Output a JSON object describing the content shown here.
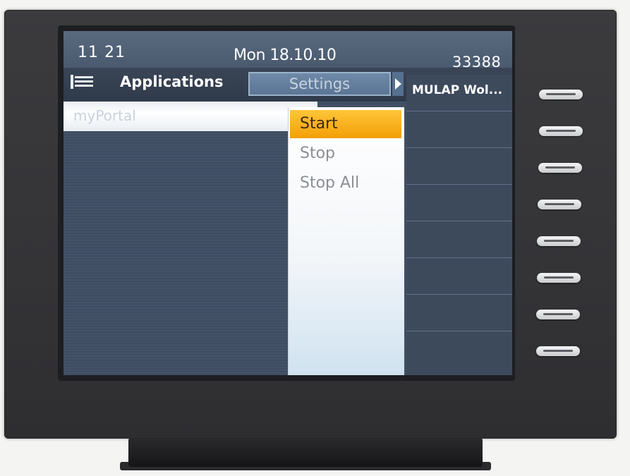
{
  "status_bar": {
    "time": "11 21",
    "date": "Mon 18.10.10",
    "extension": "33388"
  },
  "tabs": {
    "menu_icon": "menu-list-icon",
    "applications_label": "Applications",
    "settings_label": "Settings",
    "next_icon": "triangle-right-icon"
  },
  "list": {
    "items": [
      {
        "label": "myPortal"
      }
    ]
  },
  "dropdown": {
    "items": [
      {
        "label": "Start",
        "selected": true
      },
      {
        "label": "Stop",
        "selected": false
      },
      {
        "label": "Stop All",
        "selected": false
      }
    ]
  },
  "function_keys": {
    "labels": [
      "MULAP Wol...",
      "",
      "",
      "",
      "",
      "",
      "",
      ""
    ]
  },
  "colors": {
    "selection_highlight": "#f3a007",
    "screen_background": "#43526a",
    "header_background": "#495a6f",
    "settings_tab": "#5b7594"
  }
}
